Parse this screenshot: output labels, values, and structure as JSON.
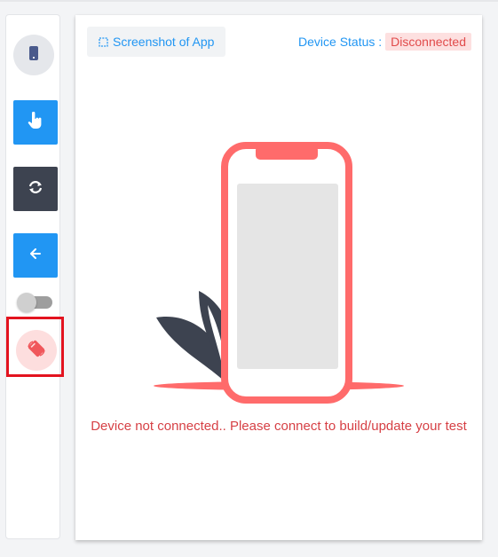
{
  "panel": {
    "screenshot_label": "Screenshot of App",
    "status_label": "Device Status :",
    "status_value": "Disconnected",
    "message": "Device not connected.. Please connect to build/update your test"
  },
  "sidebar": {
    "items": [
      {
        "name": "device",
        "icon": "mobile-device-icon",
        "interactable": true
      },
      {
        "name": "tap",
        "icon": "hand-pointer-icon",
        "interactable": true
      },
      {
        "name": "refresh",
        "icon": "sync-icon",
        "interactable": true
      },
      {
        "name": "back",
        "icon": "arrow-left-icon",
        "interactable": true
      },
      {
        "name": "toggle",
        "icon": "toggle-switch",
        "state": "off",
        "interactable": true
      },
      {
        "name": "rotate",
        "icon": "rotate-device-icon",
        "interactable": true,
        "highlighted": true
      }
    ]
  },
  "colors": {
    "accent_blue": "#2196f3",
    "dark": "#3d4350",
    "danger": "#e14b4b",
    "danger_bg": "#fde0e0",
    "highlight_border": "#e3131f",
    "phone": "#ff6b6b"
  }
}
